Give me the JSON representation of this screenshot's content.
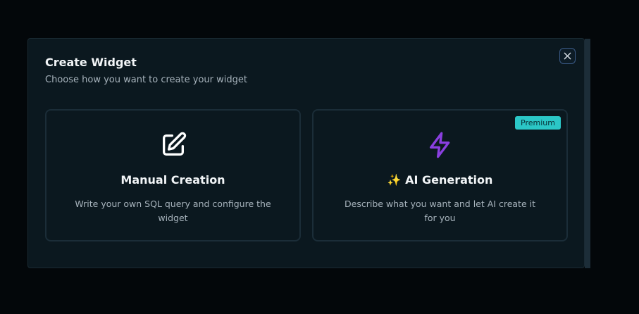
{
  "modal": {
    "title": "Create Widget",
    "subtitle": "Choose how you want to create your widget",
    "close_icon": "close-icon"
  },
  "options": [
    {
      "icon": "edit-icon",
      "title": "Manual Creation",
      "description": "Write your own SQL query and configure the widget"
    },
    {
      "icon": "lightning-icon",
      "title": "✨ AI Generation",
      "description": "Describe what you want and let AI create it for you",
      "badge": "Premium"
    }
  ],
  "colors": {
    "accent_purple": "#8a3fe0",
    "badge_teal": "#2bc7c7",
    "close_border": "#3a5a86"
  }
}
